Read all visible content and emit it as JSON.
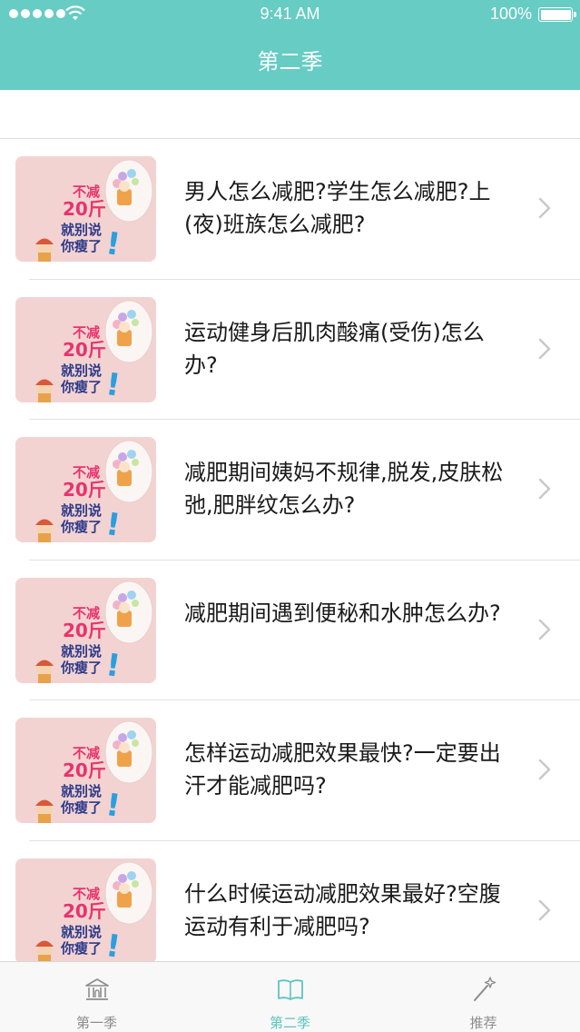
{
  "status_bar": {
    "time": "9:41 AM",
    "battery": "100%"
  },
  "nav": {
    "title": "第二季"
  },
  "thumbnail": {
    "line1": "不减",
    "line2": "20斤",
    "line3": "就别说",
    "line4": "你瘦了",
    "mark": "!"
  },
  "list": [
    {
      "title": "男人怎么减肥?学生怎么减肥?上(夜)班族怎么减肥?"
    },
    {
      "title": "运动健身后肌肉酸痛(受伤)怎么办?"
    },
    {
      "title": "减肥期间姨妈不规律,脱发,皮肤松弛,肥胖纹怎么办?"
    },
    {
      "title": "减肥期间遇到便秘和水肿怎么办?"
    },
    {
      "title": "怎样运动减肥效果最快?一定要出汗才能减肥吗?"
    },
    {
      "title": "什么时候运动减肥效果最好?空腹运动有利于减肥吗?"
    }
  ],
  "tabs": [
    {
      "label": "第一季",
      "icon": "bank-icon",
      "active": false
    },
    {
      "label": "第二季",
      "icon": "book-icon",
      "active": true
    },
    {
      "label": "推荐",
      "icon": "magic-wand-icon",
      "active": false
    }
  ],
  "colors": {
    "accent": "#66ccc4",
    "tab_active": "#5cc6be",
    "tab_inactive": "#8c8c8c",
    "thumb_bg": "#f3d3d1"
  }
}
